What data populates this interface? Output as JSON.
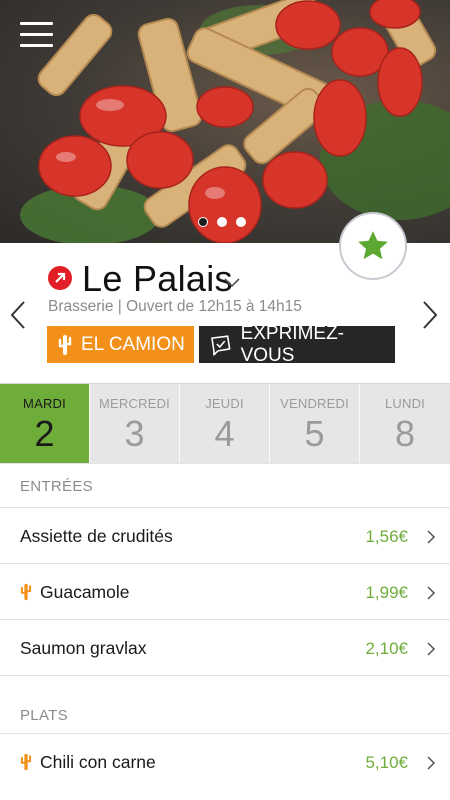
{
  "restaurant": {
    "name": "Le Palais",
    "subtitle": "Brasserie | Ouvert de 12h15 à 14h15"
  },
  "actions": {
    "camion_label": "EL CAMION",
    "express_label": "EXPRIMEZ-VOUS"
  },
  "carousel": {
    "page_count": 3,
    "active_index": 0
  },
  "days": [
    {
      "name": "MARDI",
      "number": "2",
      "active": true
    },
    {
      "name": "MERCREDI",
      "number": "3",
      "active": false
    },
    {
      "name": "JEUDI",
      "number": "4",
      "active": false
    },
    {
      "name": "VENDREDI",
      "number": "5",
      "active": false
    },
    {
      "name": "LUNDI",
      "number": "8",
      "active": false
    }
  ],
  "sections": [
    {
      "title": "ENTRÉES",
      "items": [
        {
          "name": "Assiette de crudités",
          "price": "1,56€",
          "icon": ""
        },
        {
          "name": "Guacamole",
          "price": "1,99€",
          "icon": "cactus-icon"
        },
        {
          "name": "Saumon gravlax",
          "price": "2,10€",
          "icon": ""
        }
      ]
    },
    {
      "title": "PLATS",
      "items": [
        {
          "name": "Chili con carne",
          "price": "5,10€",
          "icon": "cactus-icon"
        }
      ]
    }
  ],
  "colors": {
    "accent_green": "#6fad3a",
    "camion_orange": "#f39019",
    "express_dark": "#262626",
    "resto_red": "#e21f26"
  },
  "icons": {
    "menu": "hamburger-menu-icon",
    "favorite": "star-icon",
    "resto": "arrow-up-right-icon",
    "camion": "cactus-icon",
    "express": "speech-checkmark-icon"
  }
}
